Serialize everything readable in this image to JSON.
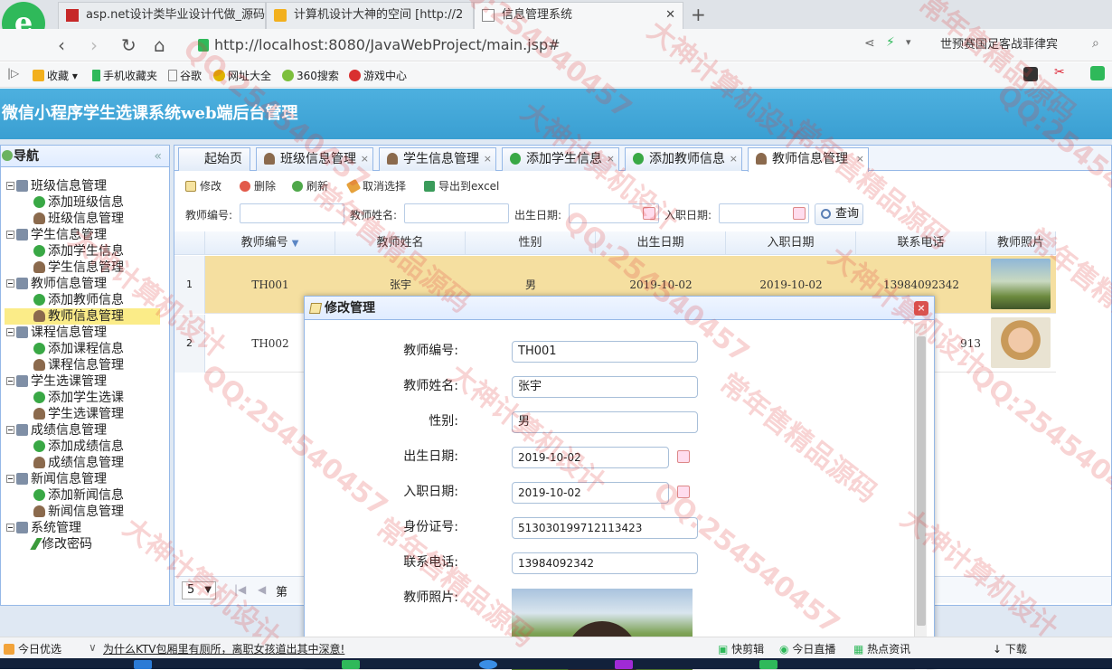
{
  "browser": {
    "tabs": [
      {
        "label": "asp.net设计类毕业设计代做_源码"
      },
      {
        "label": "计算机设计大神的空间 [http://2"
      },
      {
        "label": "信息管理系统"
      }
    ],
    "url": "http://localhost:8080/JavaWebProject/main.jsp#",
    "search_hint": "世预赛国足客战菲律宾",
    "bookmarks": [
      "收藏",
      "手机收藏夹",
      "谷歌",
      "网址大全",
      "360搜索",
      "游戏中心"
    ]
  },
  "app": {
    "title": "微信小程序学生选课系统web端后台管理",
    "nav_title": "导航",
    "nav_collapse": "«",
    "tree": [
      {
        "label": "班级信息管理",
        "children": [
          {
            "label": "添加班级信息",
            "icon": "add-icon"
          },
          {
            "label": "班级信息管理",
            "icon": "user-icon"
          }
        ]
      },
      {
        "label": "学生信息管理",
        "children": [
          {
            "label": "添加学生信息",
            "icon": "add-icon"
          },
          {
            "label": "学生信息管理",
            "icon": "user-icon"
          }
        ]
      },
      {
        "label": "教师信息管理",
        "children": [
          {
            "label": "添加教师信息",
            "icon": "add-icon"
          },
          {
            "label": "教师信息管理",
            "icon": "user-icon",
            "selected": true
          }
        ]
      },
      {
        "label": "课程信息管理",
        "children": [
          {
            "label": "添加课程信息",
            "icon": "add-icon"
          },
          {
            "label": "课程信息管理",
            "icon": "user-icon"
          }
        ]
      },
      {
        "label": "学生选课管理",
        "children": [
          {
            "label": "添加学生选课",
            "icon": "add-icon"
          },
          {
            "label": "学生选课管理",
            "icon": "user-icon"
          }
        ]
      },
      {
        "label": "成绩信息管理",
        "children": [
          {
            "label": "添加成绩信息",
            "icon": "add-icon"
          },
          {
            "label": "成绩信息管理",
            "icon": "user-icon"
          }
        ]
      },
      {
        "label": "新闻信息管理",
        "children": [
          {
            "label": "添加新闻信息",
            "icon": "add-icon"
          },
          {
            "label": "新闻信息管理",
            "icon": "user-icon"
          }
        ]
      },
      {
        "label": "系统管理",
        "children": [
          {
            "label": "修改密码",
            "icon": "pencil-icon"
          }
        ]
      }
    ],
    "tabs": [
      "起始页",
      "班级信息管理",
      "学生信息管理",
      "添加学生信息",
      "添加教师信息",
      "教师信息管理"
    ],
    "toolbar": {
      "edit": "修改",
      "delete": "删除",
      "refresh": "刷新",
      "cancel_select": "取消选择",
      "export": "导出到excel"
    },
    "filters": {
      "teacher_no": "教师编号:",
      "teacher_name": "教师姓名:",
      "birth_date": "出生日期:",
      "hire_date": "入职日期:",
      "query": "查询"
    },
    "grid": {
      "columns": [
        "教师编号",
        "教师姓名",
        "性别",
        "出生日期",
        "入职日期",
        "联系电话",
        "教师照片"
      ],
      "rows": [
        {
          "no": "1",
          "id": "TH001",
          "name": "张宇",
          "gender": "男",
          "birth": "2019-10-02",
          "hire": "2019-10-02",
          "phone": "13984092342"
        },
        {
          "no": "2",
          "id": "TH002",
          "name": "",
          "gender": "",
          "birth": "",
          "hire": "",
          "phone": "913"
        }
      ]
    },
    "pager": {
      "page_size": "5",
      "page_label": "第"
    }
  },
  "dialog": {
    "title": "修改管理",
    "close": "×",
    "fields": {
      "teacher_no": {
        "label": "教师编号:",
        "value": "TH001"
      },
      "teacher_name": {
        "label": "教师姓名:",
        "value": "张宇"
      },
      "gender": {
        "label": "性别:",
        "value": "男"
      },
      "birth_date": {
        "label": "出生日期:",
        "value": "2019-10-02"
      },
      "hire_date": {
        "label": "入职日期:",
        "value": "2019-10-02"
      },
      "id_card": {
        "label": "身份证号:",
        "value": "513030199712113423"
      },
      "phone": {
        "label": "联系电话:",
        "value": "13984092342"
      },
      "photo": {
        "label": "教师照片:"
      }
    }
  },
  "statusbar": {
    "left": "今日优选",
    "news": "为什么KTV包厢里有厕所，离职女孩道出其中深意!",
    "items": [
      "快剪辑",
      "今日直播",
      "热点资讯",
      "下载"
    ]
  },
  "watermark": {
    "lines": [
      "QQ:254540457",
      "大神计算机设计",
      "常年售精品源码"
    ]
  },
  "colors": {
    "header": "#4db0df",
    "selected_row": "#f5dfa0",
    "selected_node": "#fbec88",
    "border": "#95b8e7"
  }
}
